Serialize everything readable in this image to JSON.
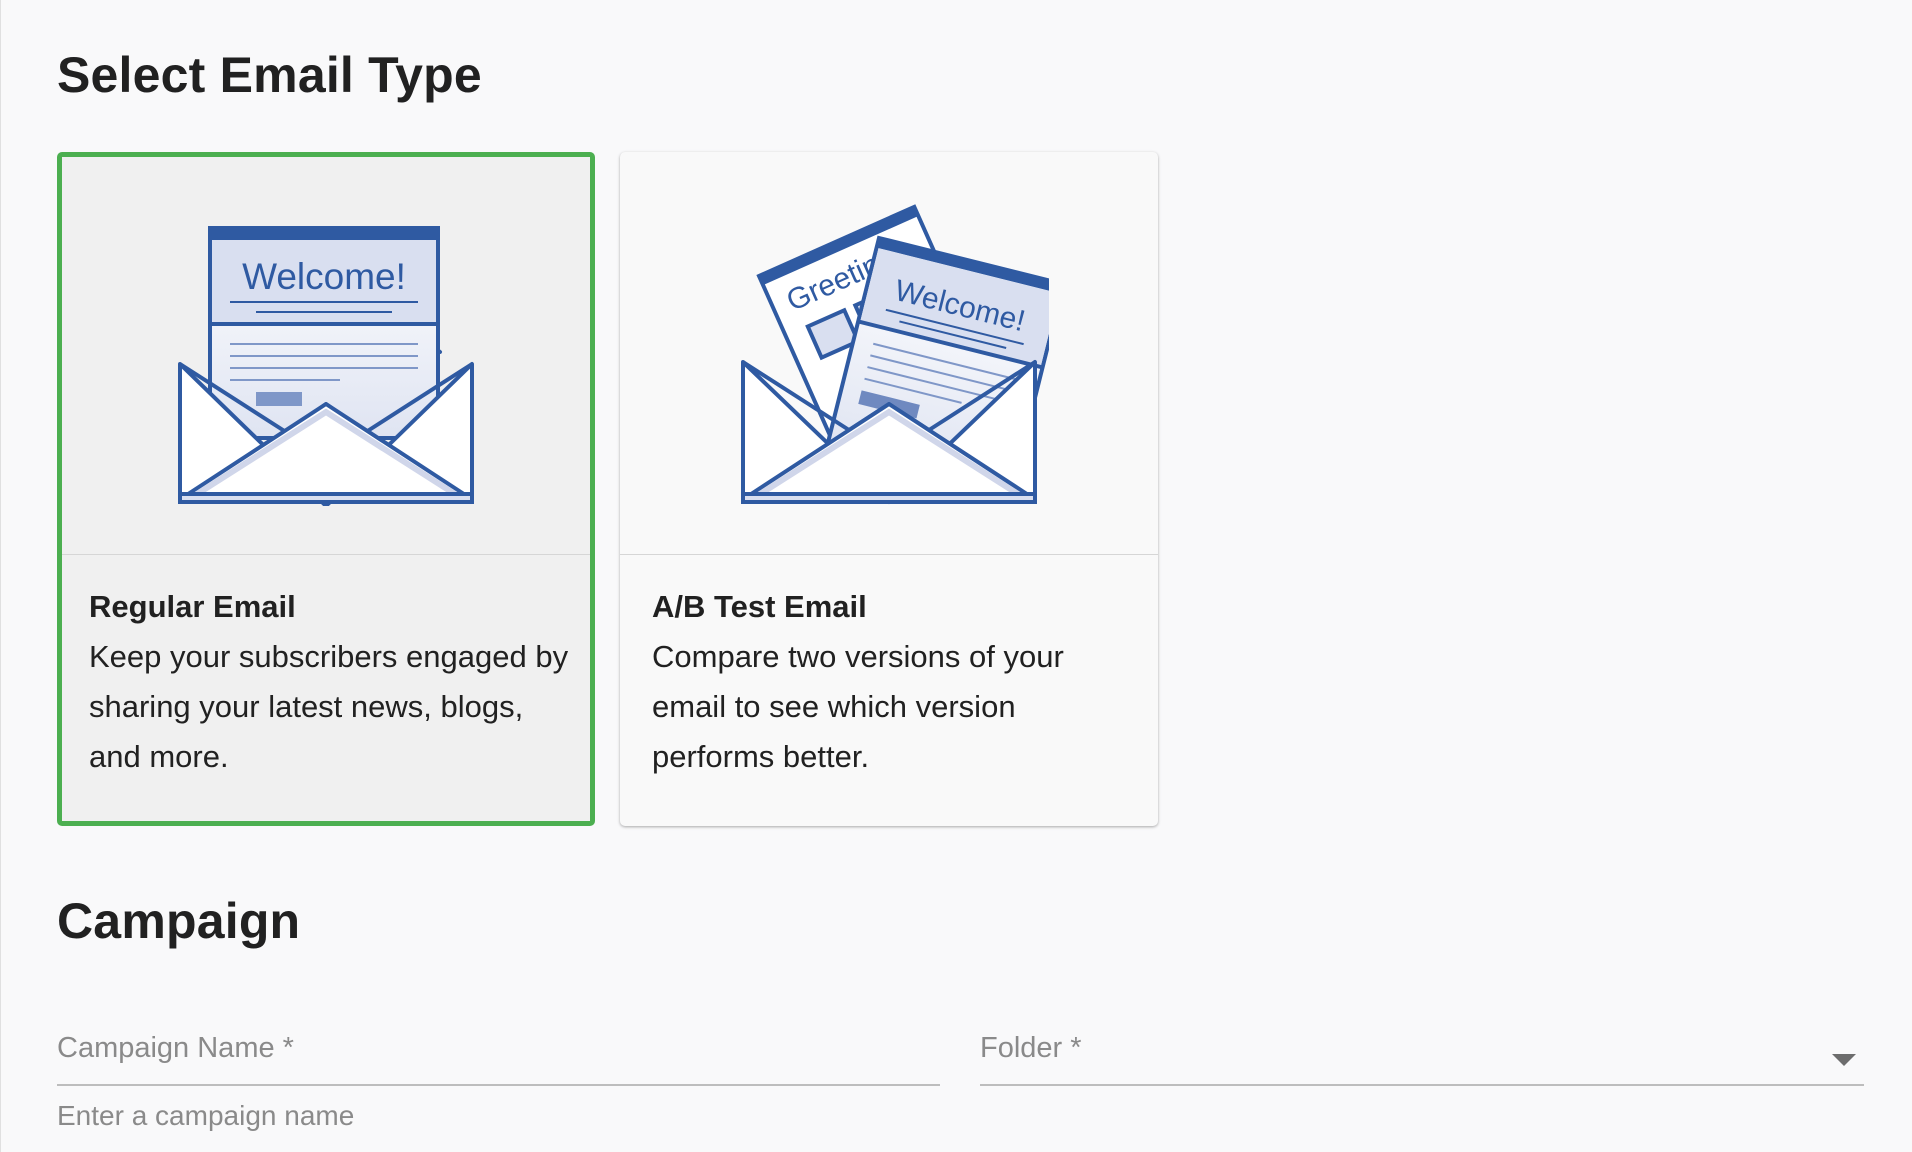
{
  "header": {
    "title": "Select Email Type"
  },
  "email_types": [
    {
      "title": "Regular Email",
      "description": "Keep your subscribers engaged by sharing your latest news, blogs, and more.",
      "illustration_text": "Welcome!",
      "selected": true
    },
    {
      "title": "A/B Test Email",
      "description": "Compare two versions of your email to see which version performs better.",
      "illustration_text_front": "Welcome!",
      "illustration_text_back": "Greeting",
      "selected": false
    }
  ],
  "campaign": {
    "title": "Campaign",
    "name_label": "Campaign Name *",
    "name_helper": "Enter a campaign name",
    "folder_label": "Folder *"
  },
  "colors": {
    "selected_border": "#4caf50",
    "illustration_blue": "#2f5aa2",
    "illustration_light": "#d9dff0"
  },
  "icons": {
    "folder_dropdown": "chevron-down-icon"
  }
}
